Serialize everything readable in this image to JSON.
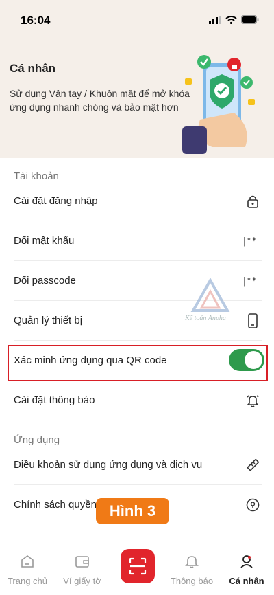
{
  "status": {
    "time": "16:04"
  },
  "hero": {
    "title": "Cá nhân",
    "description": "Sử dụng Vân tay / Khuôn mặt để mở khóa ứng dụng nhanh chóng và bảo mật hơn"
  },
  "account": {
    "section_title": "Tài khoản",
    "items": [
      {
        "label": "Cài đặt đăng nhập",
        "icon": "lock-icon"
      },
      {
        "label": "Đổi mật khẩu",
        "icon": "password-icon",
        "icon_text": "|**"
      },
      {
        "label": "Đổi passcode",
        "icon": "passcode-icon",
        "icon_text": "|**"
      },
      {
        "label": "Quản lý thiết bị",
        "icon": "phone-icon"
      },
      {
        "label": "Xác minh ứng dụng qua QR code",
        "icon": "toggle",
        "toggle_on": true
      },
      {
        "label": "Cài đặt thông báo",
        "icon": "bell-ring-icon"
      }
    ]
  },
  "app": {
    "section_title": "Ứng dụng",
    "items": [
      {
        "label": "Điều khoản sử dụng ứng dụng và dịch vụ",
        "icon": "ruler-icon"
      },
      {
        "label": "Chính sách quyền r",
        "icon": "privacy-icon"
      }
    ]
  },
  "badge": {
    "label": "Hình 3"
  },
  "bottom_nav": {
    "items": [
      {
        "label": "Trang chủ",
        "icon": "home-icon"
      },
      {
        "label": "Ví giấy tờ",
        "icon": "wallet-icon"
      },
      {
        "label": "",
        "icon": "qr-scan-icon"
      },
      {
        "label": "Thông báo",
        "icon": "bell-icon"
      },
      {
        "label": "Cá nhân",
        "icon": "profile-icon",
        "active": true
      }
    ]
  },
  "colors": {
    "accent": "#e1252c",
    "toggle_on": "#2e9a4c",
    "badge": "#f07a16",
    "hero_bg": "#f5efe9"
  }
}
